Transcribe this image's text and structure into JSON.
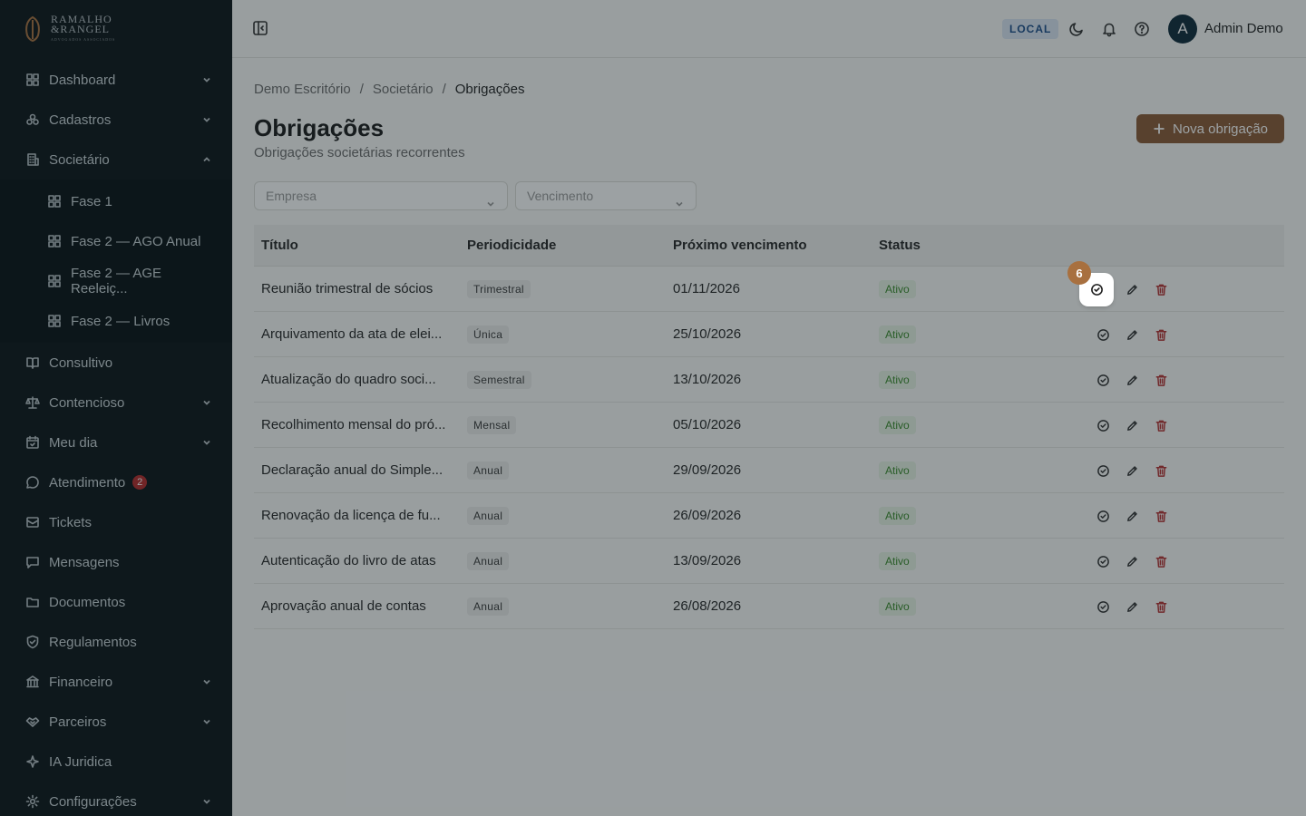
{
  "brand": {
    "line1": "RAMALHO",
    "line2": "&RANGEL",
    "line3": "ADVOGADOS ASSOCIADOS"
  },
  "sidebar": {
    "items": [
      {
        "label": "Dashboard",
        "icon": "dashboard-icon",
        "has_chevron": true
      },
      {
        "label": "Cadastros",
        "icon": "cadastros-icon",
        "has_chevron": true
      },
      {
        "label": "Societário",
        "icon": "building-icon",
        "has_chevron": true,
        "expanded": true
      },
      {
        "label": "Consultivo",
        "icon": "book-icon"
      },
      {
        "label": "Contencioso",
        "icon": "scale-icon",
        "has_chevron": true
      },
      {
        "label": "Meu dia",
        "icon": "calendar-icon",
        "has_chevron": true
      },
      {
        "label": "Atendimento",
        "icon": "chat-icon",
        "badge": "2"
      },
      {
        "label": "Tickets",
        "icon": "ticket-icon"
      },
      {
        "label": "Mensagens",
        "icon": "message-icon"
      },
      {
        "label": "Documentos",
        "icon": "folder-icon"
      },
      {
        "label": "Regulamentos",
        "icon": "shield-icon"
      },
      {
        "label": "Financeiro",
        "icon": "bank-icon",
        "has_chevron": true
      },
      {
        "label": "Parceiros",
        "icon": "handshake-icon",
        "has_chevron": true
      },
      {
        "label": "IA Juridica",
        "icon": "sparkle-icon"
      },
      {
        "label": "Configurações",
        "icon": "gear-icon",
        "has_chevron": true
      }
    ],
    "sub_items": [
      {
        "label": "Fase 1"
      },
      {
        "label": "Fase 2 — AGO Anual"
      },
      {
        "label": "Fase 2 — AGE Reeleiç..."
      },
      {
        "label": "Fase 2 — Livros"
      }
    ]
  },
  "topbar": {
    "env": "LOCAL",
    "avatar_initial": "A",
    "user_name": "Admin Demo"
  },
  "breadcrumb": {
    "items": [
      "Demo Escritório",
      "Societário",
      "Obrigações"
    ],
    "separator": "/"
  },
  "page": {
    "title": "Obrigações",
    "subtitle": "Obrigações societárias recorrentes",
    "new_button": "Nova obrigação"
  },
  "filters": {
    "company_placeholder": "Empresa",
    "due_placeholder": "Vencimento"
  },
  "table": {
    "headers": [
      "Título",
      "Periodicidade",
      "Próximo vencimento",
      "Status",
      ""
    ],
    "rows": [
      {
        "title": "Reunião trimestral de sócios",
        "period": "Trimestral",
        "due": "01/11/2026",
        "status": "Ativo"
      },
      {
        "title": "Arquivamento da ata de elei...",
        "period": "Única",
        "due": "25/10/2026",
        "status": "Ativo"
      },
      {
        "title": "Atualização do quadro soci...",
        "period": "Semestral",
        "due": "13/10/2026",
        "status": "Ativo"
      },
      {
        "title": "Recolhimento mensal do pró...",
        "period": "Mensal",
        "due": "05/10/2026",
        "status": "Ativo"
      },
      {
        "title": "Declaração anual do Simple...",
        "period": "Anual",
        "due": "29/09/2026",
        "status": "Ativo"
      },
      {
        "title": "Renovação da licença de fu...",
        "period": "Anual",
        "due": "26/09/2026",
        "status": "Ativo"
      },
      {
        "title": "Autenticação do livro de atas",
        "period": "Anual",
        "due": "13/09/2026",
        "status": "Ativo"
      },
      {
        "title": "Aprovação anual de contas",
        "period": "Anual",
        "due": "26/08/2026",
        "status": "Ativo"
      }
    ]
  },
  "tour": {
    "step": "6"
  },
  "colors": {
    "sidebar_bg": "#0c1418",
    "brand_accent": "#8a5a36",
    "status_green": "#3a8a2c",
    "delete_red": "#b53232",
    "env_blue": "#1d4f8a",
    "tour_badge": "#a8703f"
  }
}
